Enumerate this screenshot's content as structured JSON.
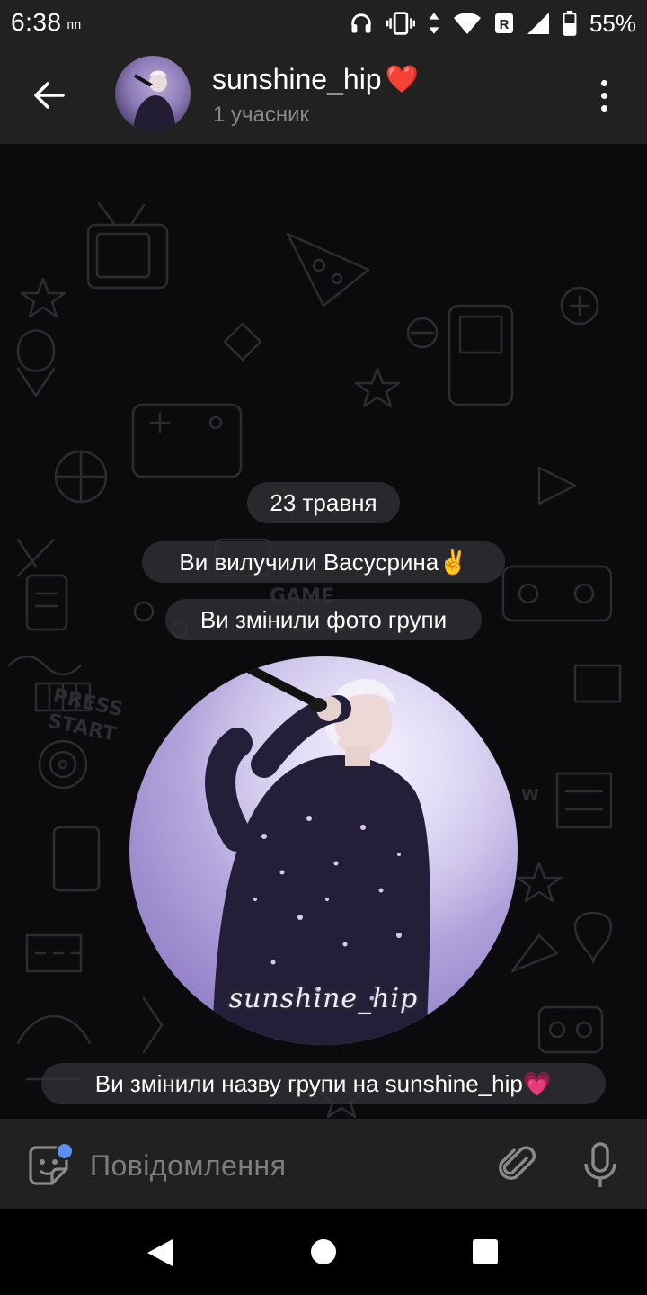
{
  "status_bar": {
    "time": "6:38",
    "time_suffix": "пп",
    "battery": "55%",
    "icons": [
      "headphones-icon",
      "vibrate-icon",
      "data-arrows-icon",
      "wifi-icon",
      "roaming-icon",
      "signal-icon",
      "battery-icon"
    ]
  },
  "header": {
    "title": "sunshine_hip",
    "title_emoji": "❤️",
    "subtitle": "1 учасник"
  },
  "messages": [
    {
      "type": "date",
      "text": "23 травня"
    },
    {
      "type": "service",
      "text": "Ви вилучили Васусрина✌️"
    },
    {
      "type": "service",
      "text": "Ви змінили фото групи"
    },
    {
      "type": "photo",
      "watermark": "sunshine_hip"
    },
    {
      "type": "service",
      "text": "Ви змінили назву групи на sunshine_hip💗"
    }
  ],
  "input": {
    "placeholder": "Повідомлення"
  },
  "colors": {
    "bar_bg": "#212121",
    "chat_bg": "#0b0b0d",
    "accent": "#5b8ff0"
  }
}
